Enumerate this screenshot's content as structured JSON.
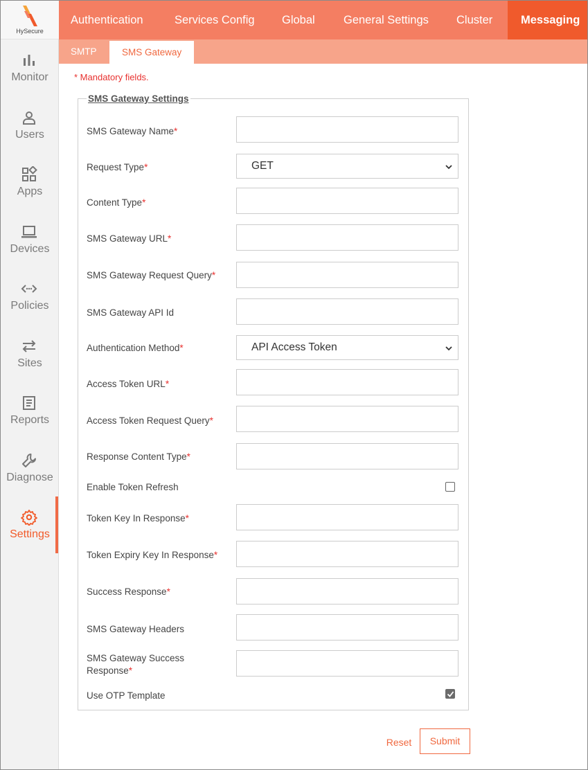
{
  "brand": {
    "name": "HySecure",
    "accent": "#f05a2c"
  },
  "sidebar": {
    "items": [
      {
        "label": "Monitor",
        "icon": "bar-chart-icon"
      },
      {
        "label": "Users",
        "icon": "user-icon"
      },
      {
        "label": "Apps",
        "icon": "apps-grid-icon"
      },
      {
        "label": "Devices",
        "icon": "laptop-icon"
      },
      {
        "label": "Policies",
        "icon": "code-arrows-icon"
      },
      {
        "label": "Sites",
        "icon": "swap-arrows-icon"
      },
      {
        "label": "Reports",
        "icon": "document-icon"
      },
      {
        "label": "Diagnose",
        "icon": "wrench-icon"
      },
      {
        "label": "Settings",
        "icon": "gear-icon",
        "active": true
      }
    ]
  },
  "topnav": {
    "tabs": [
      "Authentication",
      "Services Config",
      "Global",
      "General Settings",
      "Cluster",
      "Messaging"
    ],
    "active": "Messaging"
  },
  "subnav": {
    "tabs": [
      "SMTP",
      "SMS Gateway"
    ],
    "active": "SMS Gateway"
  },
  "form": {
    "mandatory_note": "* Mandatory fields.",
    "legend": "SMS Gateway Settings",
    "fields": {
      "sms_gateway_name": {
        "label": "SMS Gateway Name",
        "value": ""
      },
      "request_type": {
        "label": "Request Type",
        "value": "GET"
      },
      "content_type": {
        "label": "Content Type",
        "value": ""
      },
      "sms_gateway_url": {
        "label": "SMS Gateway URL",
        "value": ""
      },
      "sms_gateway_request_query": {
        "label": "SMS Gateway Request Query",
        "value": ""
      },
      "sms_gateway_api_id": {
        "label": "SMS Gateway API Id",
        "value": ""
      },
      "authentication_method": {
        "label": "Authentication Method",
        "value": "API Access Token"
      },
      "access_token_url": {
        "label": "Access Token URL",
        "value": ""
      },
      "access_token_request_query": {
        "label": "Access Token Request Query",
        "value": ""
      },
      "response_content_type": {
        "label": "Response Content Type",
        "value": ""
      },
      "enable_token_refresh": {
        "label": "Enable Token Refresh",
        "checked": false
      },
      "token_key_in_response": {
        "label": "Token Key In Response",
        "value": ""
      },
      "token_expiry_key_in_response": {
        "label": "Token Expiry Key In Response",
        "value": ""
      },
      "success_response": {
        "label": "Success Response",
        "value": ""
      },
      "sms_gateway_headers": {
        "label": "SMS Gateway Headers",
        "value": ""
      },
      "sms_gateway_success_response": {
        "label": "SMS Gateway Success Response",
        "value": ""
      },
      "use_otp_template": {
        "label": "Use OTP Template",
        "checked": true
      }
    },
    "required_marker": "*",
    "buttons": {
      "reset": "Reset",
      "submit": "Submit"
    }
  }
}
